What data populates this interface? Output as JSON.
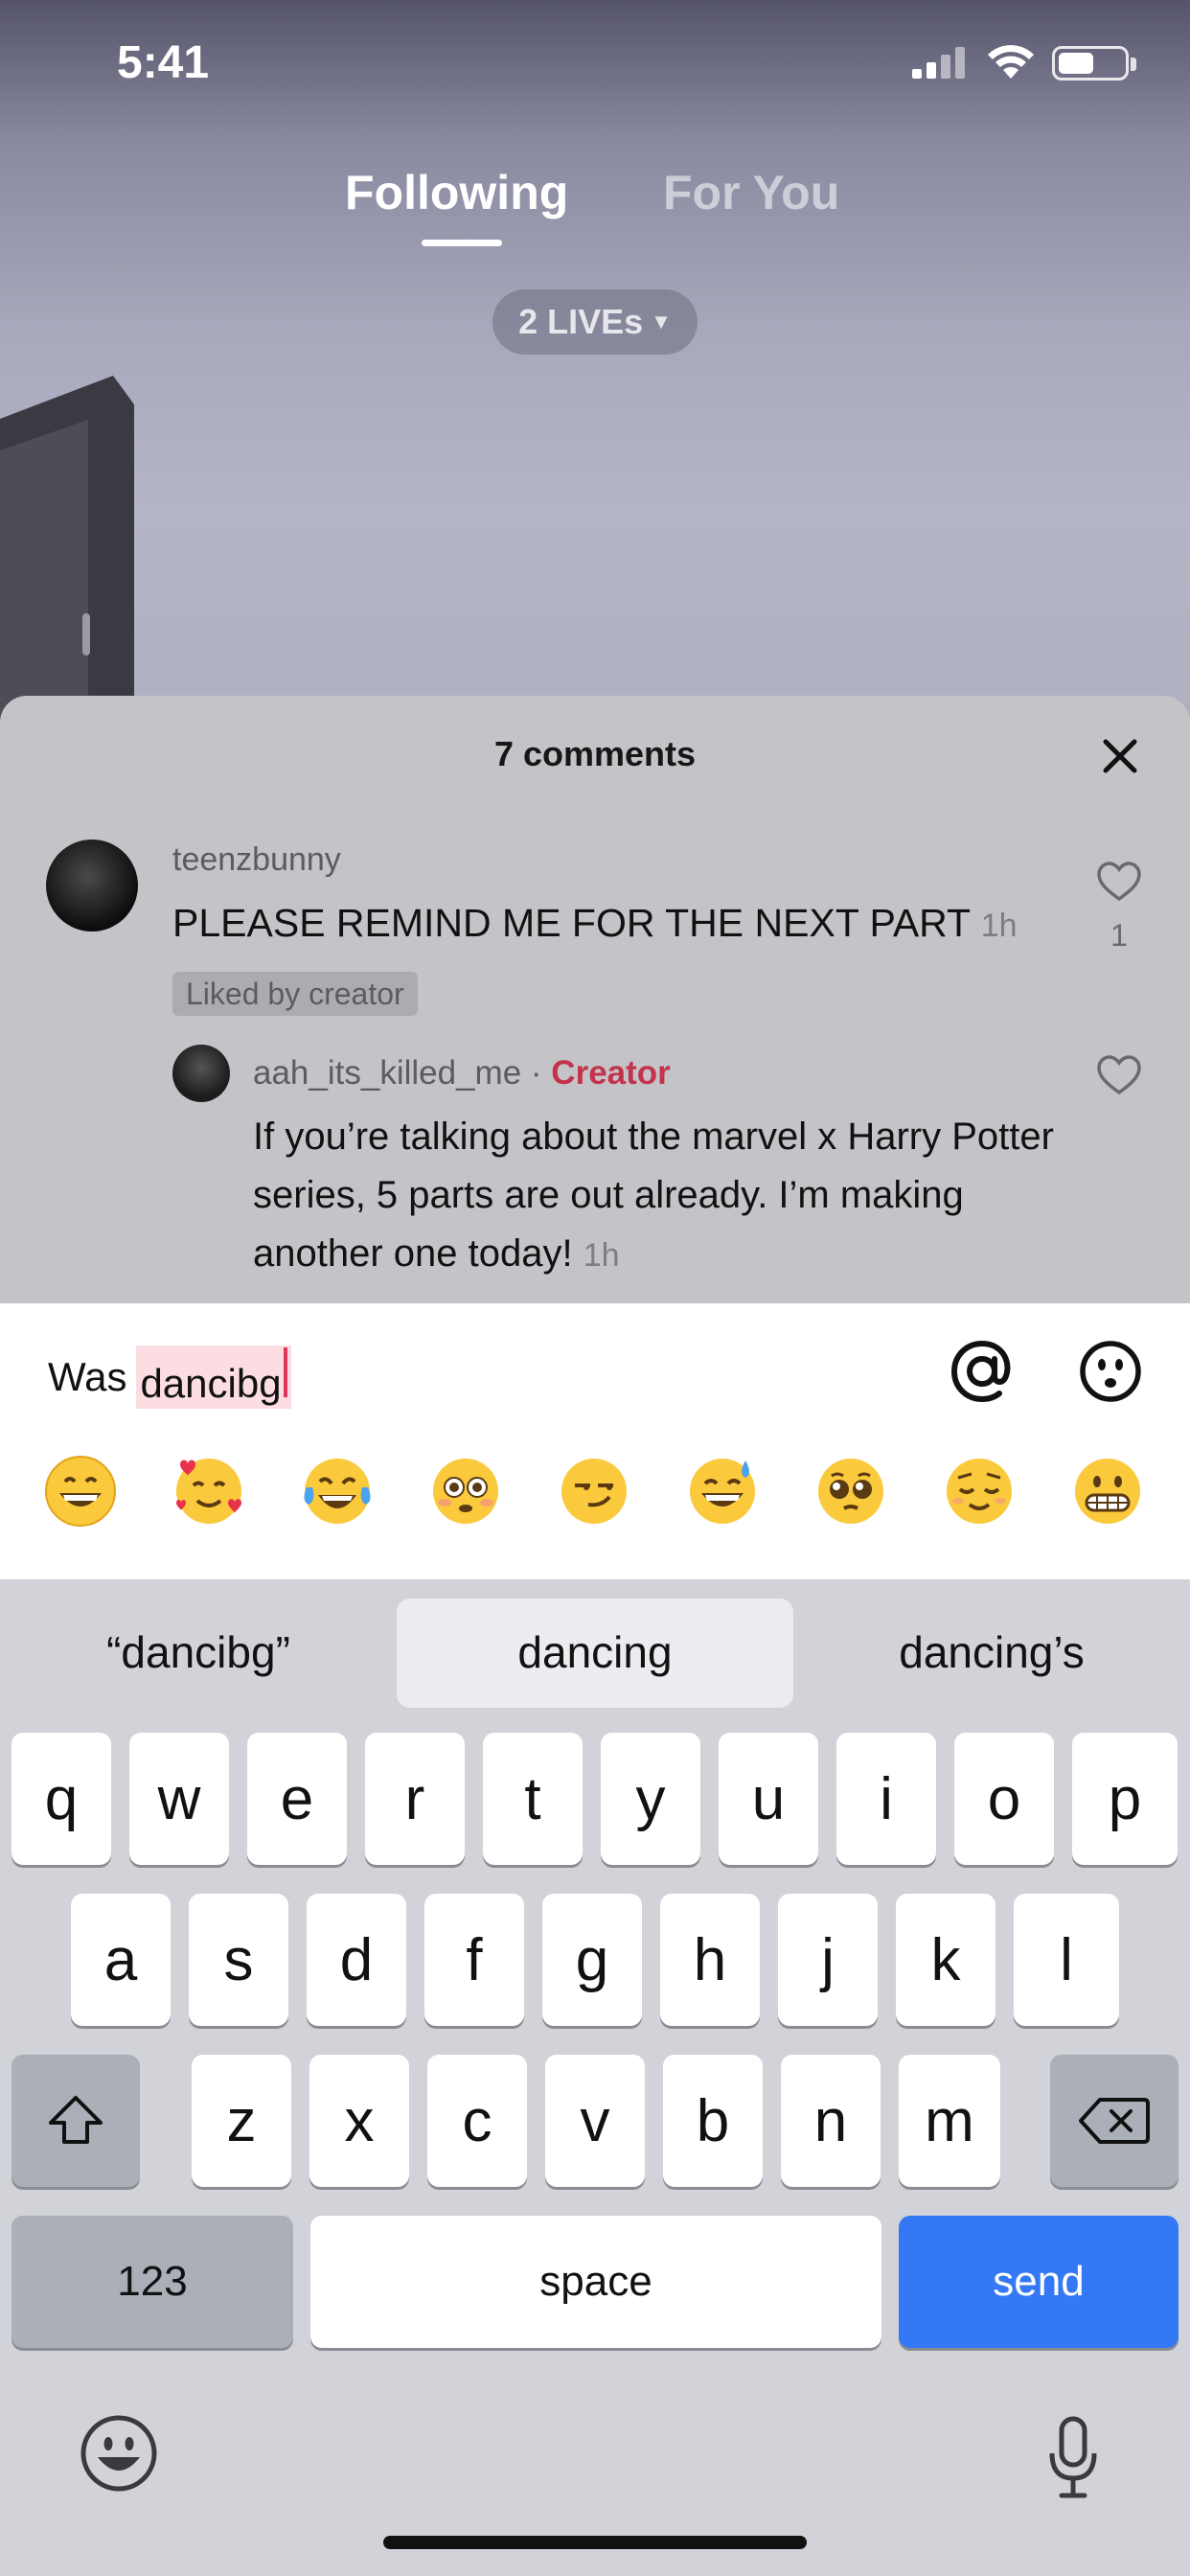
{
  "status_bar": {
    "time": "5:41"
  },
  "top_tabs": {
    "following": "Following",
    "for_you": "For You",
    "lives": "2 LIVEs"
  },
  "comments_sheet": {
    "title": "7 comments",
    "comments": [
      {
        "username": "teenzbunny",
        "text": "PLEASE REMIND ME FOR THE NEXT PART",
        "time": "1h",
        "badge": "Liked by creator",
        "likes": "1"
      }
    ],
    "reply": {
      "username": "aah_its_killed_me",
      "separator": "·",
      "tag": "Creator",
      "text": "If you’re talking about the marvel x Harry Potter series, 5 parts are out already. I’m making another one today!",
      "time": "1h"
    }
  },
  "comment_input": {
    "typed_prefix": "Was",
    "marked_text": "dancibg"
  },
  "quick_emojis": [
    "grinning-face",
    "smiling-face-with-hearts",
    "tears-of-joy",
    "flushed-face",
    "smirking-face",
    "grinning-sweat",
    "pleading-face",
    "relieved-face",
    "grimacing-face"
  ],
  "keyboard": {
    "suggestions": [
      "“dancibg”",
      "dancing",
      "dancing’s"
    ],
    "row1": [
      "q",
      "w",
      "e",
      "r",
      "t",
      "y",
      "u",
      "i",
      "o",
      "p"
    ],
    "row2": [
      "a",
      "s",
      "d",
      "f",
      "g",
      "h",
      "j",
      "k",
      "l"
    ],
    "row3": [
      "z",
      "x",
      "c",
      "v",
      "b",
      "n",
      "m"
    ],
    "numbers_key": "123",
    "space_key": "space",
    "send_key": "send"
  },
  "colors": {
    "accent": "#3478f6",
    "creator": "#c3334c",
    "cursor": "#e0335a"
  }
}
